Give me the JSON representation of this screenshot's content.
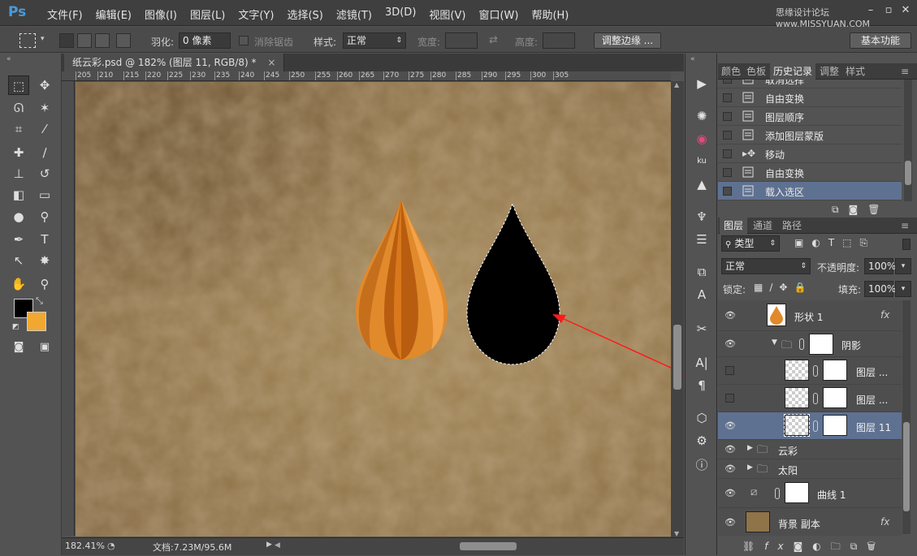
{
  "app": {
    "logo": "Ps",
    "watermark": "思缘设计论坛 www.MISSYUAN.COM"
  },
  "menu": [
    "文件(F)",
    "编辑(E)",
    "图像(I)",
    "图层(L)",
    "文字(Y)",
    "选择(S)",
    "滤镜(T)",
    "3D(D)",
    "视图(V)",
    "窗口(W)",
    "帮助(H)"
  ],
  "options": {
    "feather_label": "羽化:",
    "feather_value": "0 像素",
    "antialias_label": "消除锯齿",
    "style_label": "样式:",
    "style_value": "正常",
    "width_label": "宽度:",
    "height_label": "高度:",
    "refine_edge_button": "调整边缘 ...",
    "workspace_button": "基本功能"
  },
  "document": {
    "tab_title": "纸云彩.psd @ 182% (图层 11, RGB/8) *",
    "ruler_ticks": [
      "205",
      "210",
      "215",
      "220",
      "225",
      "230",
      "235",
      "240",
      "245",
      "250",
      "255",
      "260",
      "265",
      "270",
      "275",
      "280",
      "285",
      "290",
      "295",
      "300",
      "305"
    ],
    "zoom": "182.41%",
    "doc_size": "文档:7.23M/95.6M"
  },
  "history_panel": {
    "tabs": [
      "颜色",
      "色板",
      "历史记录",
      "调整",
      "样式"
    ],
    "active_tab": "历史记录",
    "items": [
      {
        "label": "取消选择",
        "selected": false
      },
      {
        "label": "自由变换",
        "selected": false
      },
      {
        "label": "图层顺序",
        "selected": false
      },
      {
        "label": "添加图层蒙版",
        "selected": false
      },
      {
        "label": "移动",
        "selected": false
      },
      {
        "label": "自由变换",
        "selected": false
      },
      {
        "label": "载入选区",
        "selected": true
      }
    ]
  },
  "layers_panel": {
    "tabs": [
      "图层",
      "通道",
      "路径"
    ],
    "active_tab": "图层",
    "filter_kind": "类型",
    "blend_mode": "正常",
    "opacity_label": "不透明度:",
    "opacity_value": "100%",
    "lock_label": "锁定:",
    "fill_label": "填充:",
    "fill_value": "100%",
    "fx_label": "fx",
    "layers": [
      {
        "name": "形状 1",
        "visible": true,
        "selected": false
      },
      {
        "name": "阴影",
        "visible": true,
        "selected": false
      },
      {
        "name": "图层 ...",
        "visible": false,
        "selected": false
      },
      {
        "name": "图层 ...",
        "visible": false,
        "selected": false
      },
      {
        "name": "图层 11",
        "visible": true,
        "selected": true
      },
      {
        "name": "云彩",
        "visible": true,
        "selected": false
      },
      {
        "name": "太阳",
        "visible": true,
        "selected": false
      },
      {
        "name": "曲线 1",
        "visible": true,
        "selected": false
      },
      {
        "name": "背景 副本",
        "visible": true,
        "selected": false
      }
    ]
  },
  "colors": {
    "foreground": "#000000",
    "background": "#f0a830",
    "selection_accent": "#5f7191",
    "arrow": "#ff1a1a"
  }
}
